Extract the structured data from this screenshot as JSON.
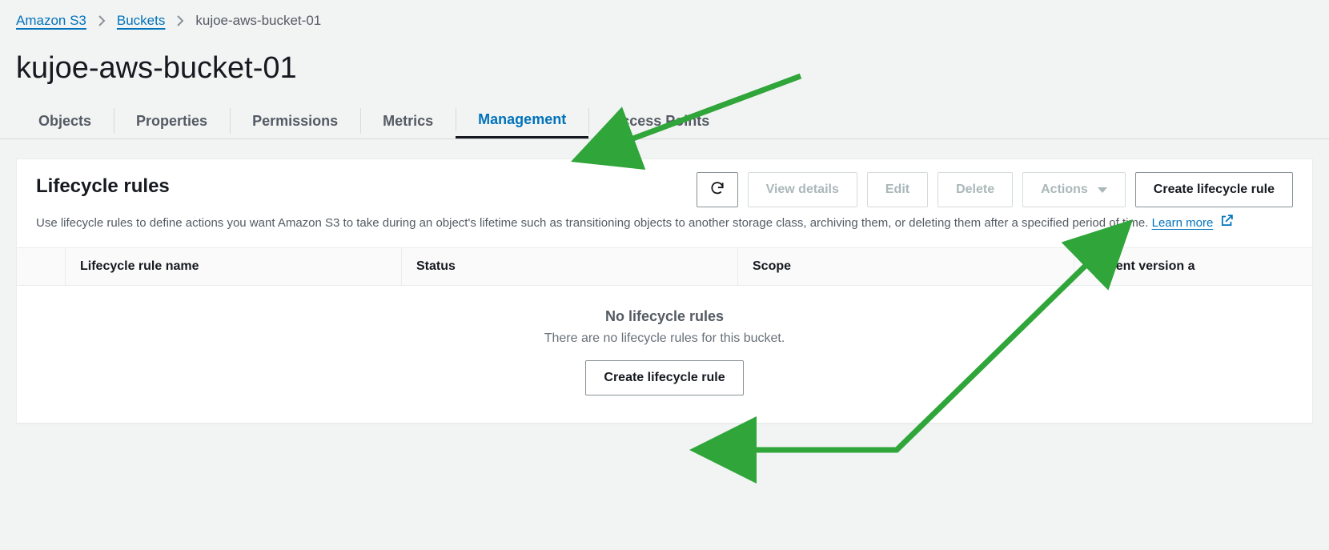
{
  "breadcrumb": {
    "root": "Amazon S3",
    "buckets": "Buckets",
    "current": "kujoe-aws-bucket-01"
  },
  "page_title": "kujoe-aws-bucket-01",
  "tabs": [
    {
      "label": "Objects"
    },
    {
      "label": "Properties"
    },
    {
      "label": "Permissions"
    },
    {
      "label": "Metrics"
    },
    {
      "label": "Management",
      "active": true
    },
    {
      "label": "Access Points"
    }
  ],
  "panel": {
    "title": "Lifecycle rules",
    "description": "Use lifecycle rules to define actions you want Amazon S3 to take during an object's lifetime such as transitioning objects to another storage class, archiving them, or deleting them after a specified period of time. ",
    "learn_more": "Learn more",
    "buttons": {
      "view_details": "View details",
      "edit": "Edit",
      "delete": "Delete",
      "actions": "Actions",
      "create": "Create lifecycle rule"
    },
    "columns": {
      "name": "Lifecycle rule name",
      "status": "Status",
      "scope": "Scope",
      "current_version": "Current version a"
    },
    "empty": {
      "title": "No lifecycle rules",
      "subtitle": "There are no lifecycle rules for this bucket.",
      "button": "Create lifecycle rule"
    }
  }
}
